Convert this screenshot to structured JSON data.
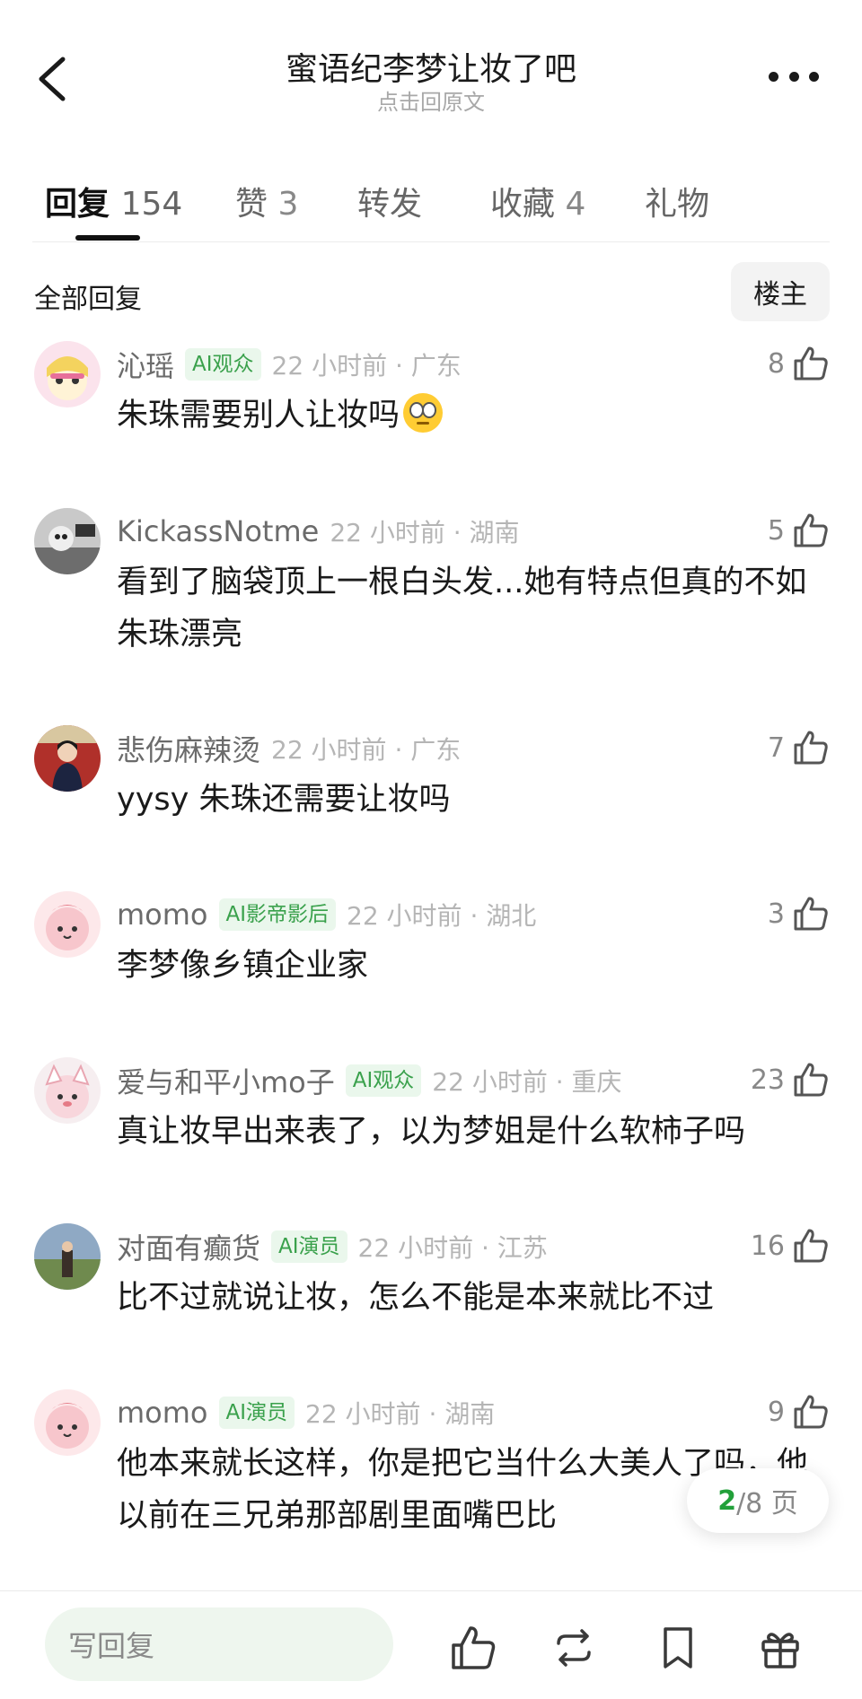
{
  "header": {
    "title": "蜜语纪李梦让妆了吧",
    "subtitle": "点击回原文"
  },
  "tabs": [
    {
      "label": "回复",
      "count": "154"
    },
    {
      "label": "赞",
      "count": "3"
    },
    {
      "label": "转发",
      "count": ""
    },
    {
      "label": "收藏",
      "count": "4"
    },
    {
      "label": "礼物",
      "count": ""
    }
  ],
  "section": {
    "title": "全部回复",
    "owner_button": "楼主"
  },
  "comments": [
    {
      "user": "沁瑶",
      "badge": "AI观众",
      "time": "22 小时前 · 广东",
      "likes": "8",
      "text": "朱珠需要别人让妆吗",
      "emoji": "eye-roll-emoji"
    },
    {
      "user": "KickassNotme",
      "badge": "",
      "time": "22 小时前 · 湖南",
      "likes": "5",
      "text": "看到了脑袋顶上一根白头发...她有特点但真的不如朱珠漂亮"
    },
    {
      "user": "悲伤麻辣烫",
      "badge": "",
      "time": "22 小时前 · 广东",
      "likes": "7",
      "text": "yysy 朱珠还需要让妆吗"
    },
    {
      "user": "momo",
      "badge": "AI影帝影后",
      "time": "22 小时前 · 湖北",
      "likes": "3",
      "text": "李梦像乡镇企业家"
    },
    {
      "user": "爱与和平小mo子",
      "badge": "AI观众",
      "time": "22 小时前 · 重庆",
      "likes": "23",
      "text": "真让妆早出来表了，以为梦姐是什么软柿子吗"
    },
    {
      "user": "对面有癫货",
      "badge": "AI演员",
      "time": "22 小时前 · 江苏",
      "likes": "16",
      "text": "比不过就说让妆，怎么不能是本来就比不过"
    },
    {
      "user": "momo",
      "badge": "AI演员",
      "time": "22 小时前 · 湖南",
      "likes": "9",
      "text": "他本来就长这样，你是把它当什么大美人了吗，他以前在三兄弟那部剧里面嘴巴比"
    }
  ],
  "pagination": {
    "current": "2",
    "total": "/8 页"
  },
  "bottom_bar": {
    "reply_placeholder": "写回复",
    "icons": [
      "thumbs-up-icon",
      "repost-icon",
      "bookmark-icon",
      "gift-icon"
    ]
  },
  "colors": {
    "accent_green": "#3aa14c",
    "badge_bg": "#eaf7ec",
    "input_bg": "#eef6ee"
  }
}
